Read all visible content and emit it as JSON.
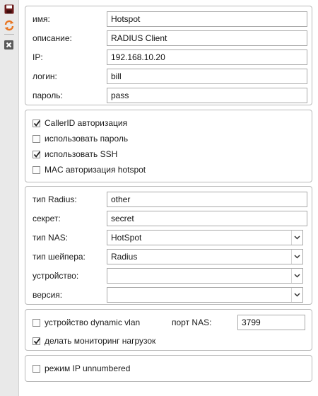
{
  "toolbar": {
    "buttons": [
      {
        "icon": "save-icon",
        "color": "#6b1a1a"
      },
      {
        "icon": "refresh-icon",
        "color": "#e8741f"
      },
      {
        "icon": "close-icon",
        "color": "#5a5a5a"
      }
    ]
  },
  "general": {
    "name_label": "имя:",
    "name_value": "Hotspot",
    "description_label": "описание:",
    "description_value": "RADIUS Client",
    "ip_label": "IP:",
    "ip_value": "192.168.10.20",
    "login_label": "логин:",
    "login_value": "bill",
    "password_label": "пароль:",
    "password_value": "pass"
  },
  "auth": {
    "callerid_label": "CallerID авторизация",
    "callerid_checked": true,
    "use_password_label": "использовать пароль",
    "use_password_checked": false,
    "use_ssh_label": "использовать SSH",
    "use_ssh_checked": true,
    "mac_auth_label": "MAC авторизация hotspot",
    "mac_auth_checked": false
  },
  "radius": {
    "type_label": "тип Radius:",
    "type_value": "other",
    "secret_label": "секрет:",
    "secret_value": "secret",
    "nas_type_label": "тип NAS:",
    "nas_type_value": "HotSpot",
    "shaper_type_label": "тип шейпера:",
    "shaper_type_value": "Radius",
    "device_label": "устройство:",
    "device_value": "",
    "version_label": "версия:",
    "version_value": ""
  },
  "vlan": {
    "dynamic_vlan_label": "устройство dynamic vlan",
    "dynamic_vlan_checked": false,
    "nas_port_label": "порт NAS:",
    "nas_port_value": "3799",
    "load_monitoring_label": "делать мониторинг нагрузок",
    "load_monitoring_checked": true
  },
  "ip_mode": {
    "unnumbered_label": "режим IP unnumbered",
    "unnumbered_checked": false
  }
}
